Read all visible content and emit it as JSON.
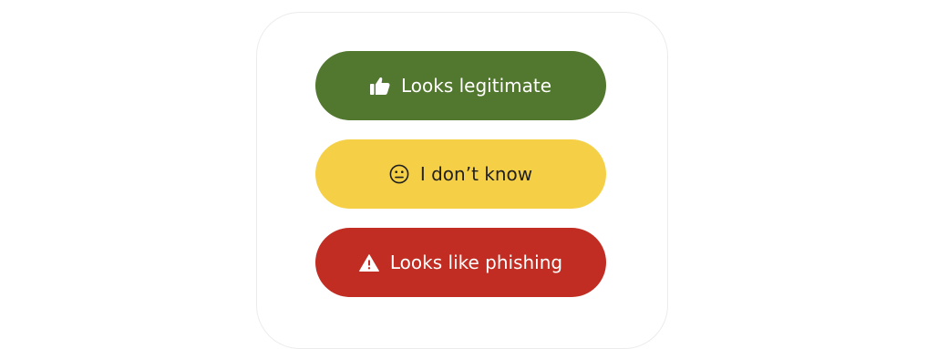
{
  "choices": [
    {
      "id": "legitimate",
      "label": "Looks legitimate",
      "icon": "thumbs-up-icon",
      "background": "#52772e",
      "text_color": "#ffffff"
    },
    {
      "id": "unsure",
      "label": "I don’t know",
      "icon": "neutral-face-icon",
      "background": "#f5d047",
      "text_color": "#1f1f1f"
    },
    {
      "id": "phishing",
      "label": "Looks like phishing",
      "icon": "warning-icon",
      "background": "#c12d22",
      "text_color": "#ffffff"
    }
  ]
}
